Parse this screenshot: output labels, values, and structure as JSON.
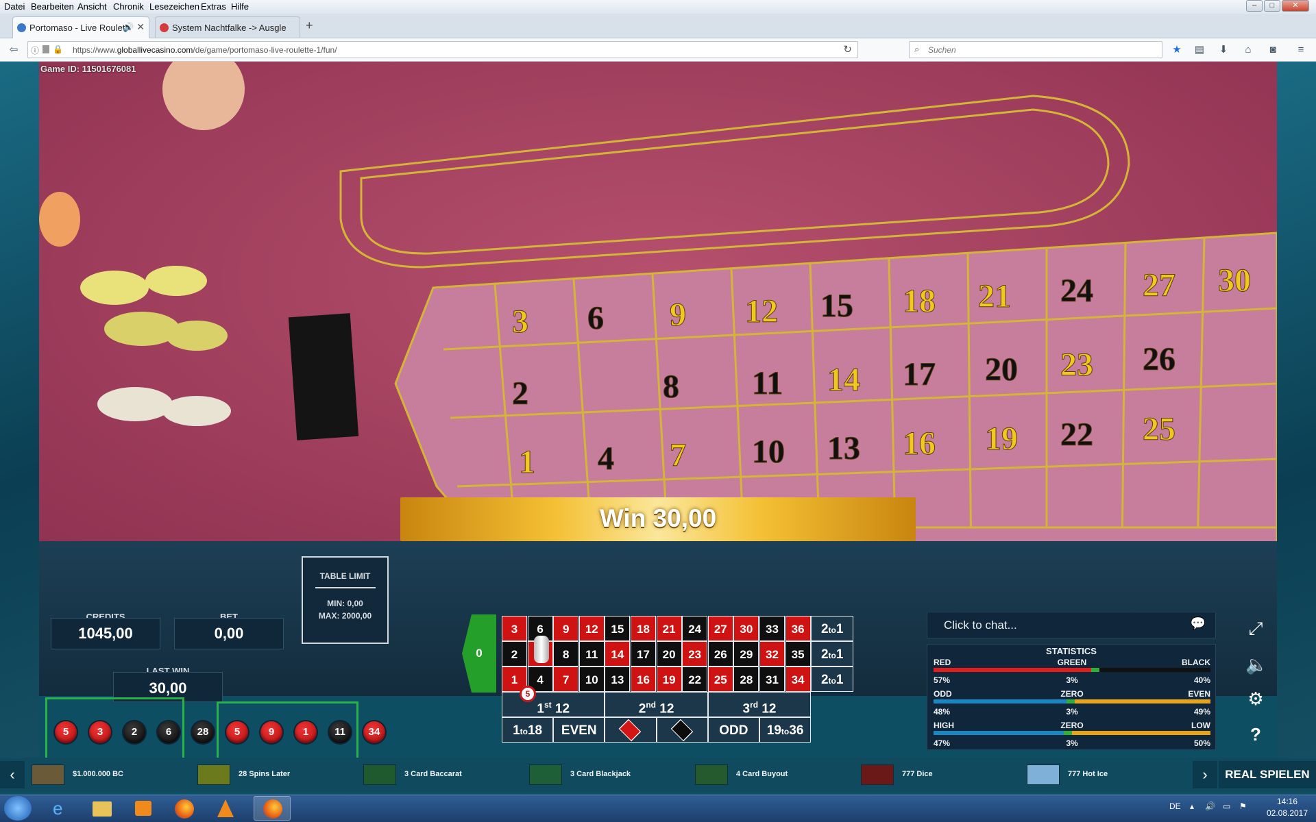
{
  "browser": {
    "menu": [
      "Datei",
      "Bearbeiten",
      "Ansicht",
      "Chronik",
      "Lesezeichen",
      "Extras",
      "Hilfe"
    ],
    "tabs": [
      {
        "title": "Portomaso - Live Roulett",
        "active": true
      },
      {
        "title": "System Nachtfalke -> Ausgle",
        "active": false
      }
    ],
    "url_prefix": "https://www.",
    "url_domain": "globallivecasino.com",
    "url_path": "/de/game/portomaso-live-roulette-1/fun/",
    "search_placeholder": "Suchen"
  },
  "game": {
    "game_id_label": "Game ID: 11501676081",
    "credits_label": "CREDITS",
    "credits_value": "1045,00",
    "bet_label": "BET",
    "bet_value": "0,00",
    "last_win_label": "LAST WIN",
    "last_win_value": "30,00",
    "table_limit_label": "TABLE LIMIT",
    "min_label": "MIN: 0,00",
    "max_label": "MAX: 2000,00",
    "win_message": "Win 30,00",
    "history": [
      {
        "n": "5",
        "color": "red"
      },
      {
        "n": "3",
        "color": "red"
      },
      {
        "n": "2",
        "color": "black"
      },
      {
        "n": "6",
        "color": "black"
      },
      {
        "n": "28",
        "color": "black"
      },
      {
        "n": "5",
        "color": "red"
      },
      {
        "n": "9",
        "color": "red"
      },
      {
        "n": "1",
        "color": "red"
      },
      {
        "n": "11",
        "color": "black"
      },
      {
        "n": "34",
        "color": "red"
      }
    ],
    "table": {
      "zero": "0",
      "rows": [
        [
          "3",
          "6",
          "9",
          "12",
          "15",
          "18",
          "21",
          "24",
          "27",
          "30",
          "33",
          "36"
        ],
        [
          "2",
          "5",
          "8",
          "11",
          "14",
          "17",
          "20",
          "23",
          "26",
          "29",
          "32",
          "35"
        ],
        [
          "1",
          "4",
          "7",
          "10",
          "13",
          "16",
          "19",
          "22",
          "25",
          "28",
          "31",
          "34"
        ]
      ],
      "red_numbers": [
        "1",
        "3",
        "5",
        "7",
        "9",
        "12",
        "14",
        "16",
        "18",
        "19",
        "21",
        "23",
        "25",
        "27",
        "30",
        "32",
        "34",
        "36"
      ],
      "column_bet": "2to1",
      "dozens": [
        "1st 12",
        "2nd 12",
        "3rd 12"
      ],
      "outside": [
        "1to18",
        "EVEN",
        "",
        "",
        "ODD",
        "19to36"
      ],
      "chip_value": "5"
    },
    "chat_placeholder": "Click to chat...",
    "statistics": {
      "title": "STATISTICS",
      "rows": [
        {
          "left": "RED",
          "mid": "GREEN",
          "right": "BLACK",
          "lp": "57%",
          "mp": "3%",
          "rp": "40%",
          "lc": "#e11d1d",
          "mc": "#2fae3a",
          "rc": "#111111",
          "lv": 57,
          "mv": 3,
          "rv": 40
        },
        {
          "left": "ODD",
          "mid": "ZERO",
          "right": "EVEN",
          "lp": "48%",
          "mp": "3%",
          "rp": "49%",
          "lc": "#1b86c4",
          "mc": "#2fae3a",
          "rc": "#e8a417",
          "lv": 48,
          "mv": 3,
          "rv": 49
        },
        {
          "left": "HIGH",
          "mid": "ZERO",
          "right": "LOW",
          "lp": "47%",
          "mp": "3%",
          "rp": "50%",
          "lc": "#1b86c4",
          "mc": "#2fae3a",
          "rc": "#e8a417",
          "lv": 47,
          "mv": 3,
          "rv": 50
        }
      ]
    }
  },
  "games_strip": [
    {
      "name": "$1.000.000 BC",
      "thumb": "#6b5a38"
    },
    {
      "name": "28 Spins Later",
      "thumb": "#6a7a1c"
    },
    {
      "name": "3 Card Baccarat",
      "thumb": "#1e5a2e"
    },
    {
      "name": "3 Card Blackjack",
      "thumb": "#1f5f37"
    },
    {
      "name": "4 Card Buyout",
      "thumb": "#245a2e"
    },
    {
      "name": "777 Dice",
      "thumb": "#6a1818"
    },
    {
      "name": "777 Hot Ice",
      "thumb": "#7fb1d8"
    }
  ],
  "real_button": "REAL SPIELEN",
  "tray": {
    "lang": "DE",
    "time": "14:16",
    "date": "02.08.2017"
  }
}
